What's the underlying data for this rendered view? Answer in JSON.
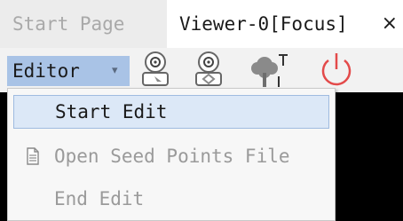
{
  "tabs": {
    "start_page": "Start Page",
    "viewer": "Viewer-0[Focus]",
    "close": "×"
  },
  "toolbar": {
    "editor_label": "Editor",
    "editor_arrow": "▾",
    "icons": [
      "seed-point-edit-icon",
      "seed-point-select-icon",
      "tree-text-icon",
      "power-icon"
    ]
  },
  "menu": {
    "items": [
      {
        "label": "Start Edit",
        "enabled": true,
        "highlighted": true
      },
      {
        "label": "Open Seed Points File",
        "enabled": false,
        "icon": "document-icon"
      },
      {
        "label": "End Edit",
        "enabled": false
      }
    ]
  },
  "colors": {
    "highlight": "#dce8f7",
    "editor_button": "#a9c3e6",
    "power": "#e34a4a",
    "viewer_bg": "#000000"
  }
}
